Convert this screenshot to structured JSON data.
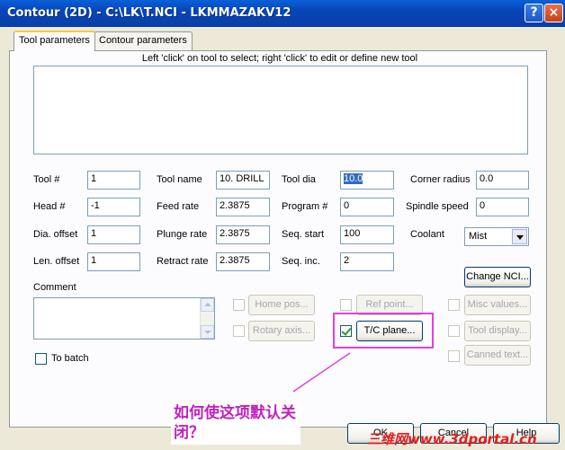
{
  "window": {
    "title": "Contour (2D) - C:\\LK\\T.NCI - LKMMAZAKV12",
    "help_glyph": "?",
    "close_glyph": "×"
  },
  "tabs": [
    {
      "label": "Tool parameters"
    },
    {
      "label": "Contour parameters"
    }
  ],
  "hint": "Left 'click' on tool to select; right 'click' to edit or define new tool",
  "fields": {
    "tool_num": {
      "label": "Tool #",
      "value": "1"
    },
    "head_num": {
      "label": "Head #",
      "value": "-1"
    },
    "dia_offset": {
      "label": "Dia. offset",
      "value": "1"
    },
    "len_offset": {
      "label": "Len. offset",
      "value": "1"
    },
    "tool_name": {
      "label": "Tool name",
      "value": "10. DRILL"
    },
    "feed_rate": {
      "label": "Feed rate",
      "value": "2.3875"
    },
    "plunge_rate": {
      "label": "Plunge rate",
      "value": "2.3875"
    },
    "retract_rate": {
      "label": "Retract rate",
      "value": "2.3875"
    },
    "tool_dia": {
      "label": "Tool dia",
      "value": "10.0"
    },
    "program_num": {
      "label": "Program #",
      "value": "0"
    },
    "seq_start": {
      "label": "Seq. start",
      "value": "100"
    },
    "seq_inc": {
      "label": "Seq. inc.",
      "value": "2"
    },
    "corner_radius": {
      "label": "Corner radius",
      "value": "0.0"
    },
    "spindle_speed": {
      "label": "Spindle speed",
      "value": "0"
    },
    "coolant": {
      "label": "Coolant",
      "value": "Mist"
    }
  },
  "comment_label": "Comment",
  "buttons": {
    "change_nci": "Change NCI...",
    "home_pos": "Home pos...",
    "ref_point": "Ref point...",
    "misc_values": "Misc values...",
    "rotary_axis": "Rotary axis...",
    "tc_plane": "T/C plane...",
    "tool_display": "Tool display...",
    "canned_text": "Canned text...",
    "ok": "OK",
    "cancel": "Cancel",
    "help": "Help"
  },
  "checkboxes": {
    "home_pos_checked": false,
    "ref_point_checked": false,
    "misc_values_checked": false,
    "rotary_axis_checked": false,
    "tc_plane_checked": true,
    "tool_display_checked": false,
    "canned_text_checked": false,
    "to_batch": {
      "label": "To batch",
      "checked": false
    }
  },
  "annotation": {
    "text": "如何使这项默认关闭？",
    "color": "#e040e0"
  },
  "watermark": "三维网www.3dportal.cn"
}
